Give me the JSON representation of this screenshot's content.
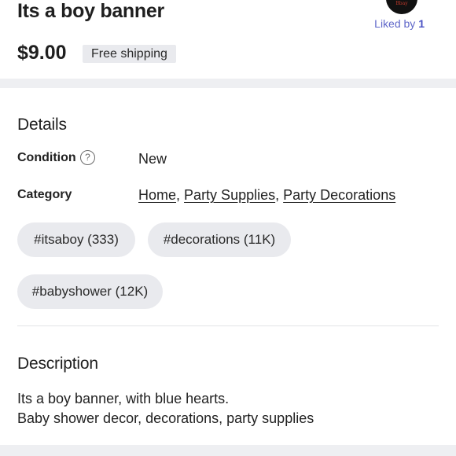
{
  "listing": {
    "title": "Its a boy banner",
    "price": "$9.00",
    "shipping_badge": "Free shipping",
    "liked_by_label": "Liked by",
    "liked_by_count": "1",
    "seller_avatar_text": "Bbay"
  },
  "details": {
    "heading": "Details",
    "condition_label": "Condition",
    "condition_value": "New",
    "category_label": "Category",
    "categories": [
      "Home",
      "Party Supplies",
      "Party Decorations"
    ],
    "separator": ","
  },
  "tags": [
    "#itsaboy (333)",
    "#decorations (11K)",
    "#babyshower (12K)"
  ],
  "description": {
    "heading": "Description",
    "lines": [
      "Its a boy banner, with blue hearts.",
      "Baby shower decor, decorations, party supplies"
    ]
  },
  "icons": {
    "help": "question-circle-icon"
  }
}
